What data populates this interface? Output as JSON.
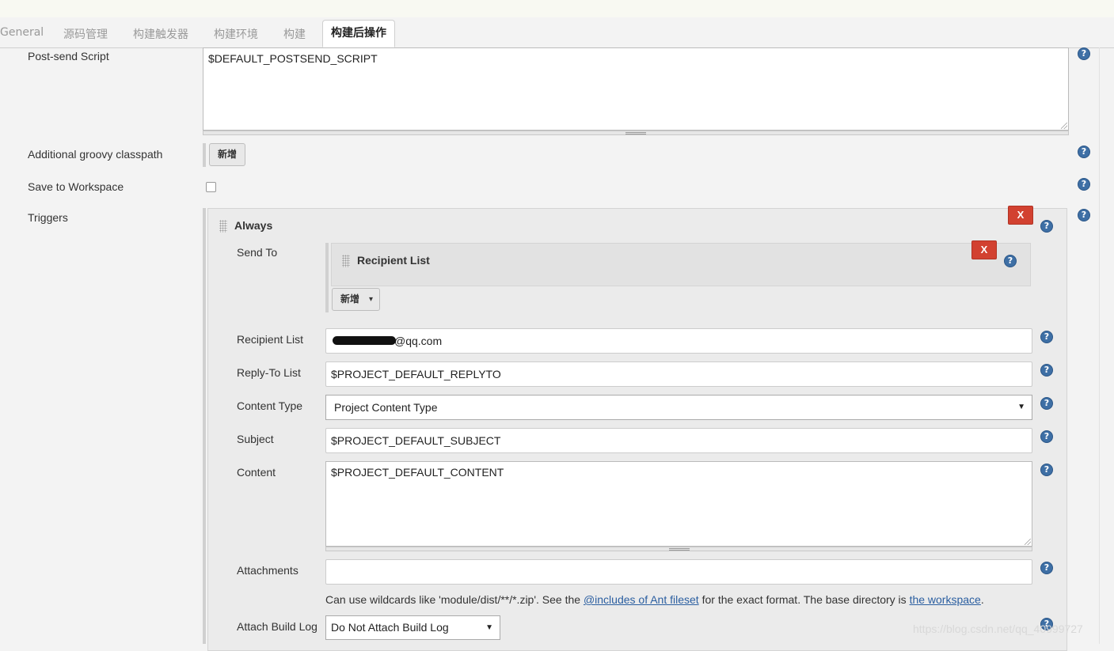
{
  "tabs": [
    {
      "label": "General"
    },
    {
      "label": "源码管理"
    },
    {
      "label": "构建触发器"
    },
    {
      "label": "构建环境"
    },
    {
      "label": "构建"
    },
    {
      "label": "构建后操作",
      "active": true
    }
  ],
  "post_send_script": {
    "label": "Post-send Script",
    "value": "$DEFAULT_POSTSEND_SCRIPT"
  },
  "groovy_classpath": {
    "label": "Additional groovy classpath",
    "add_button": "新增"
  },
  "save_workspace": {
    "label": "Save to Workspace",
    "checked": false
  },
  "triggers": {
    "label": "Triggers",
    "always": {
      "title": "Always",
      "delete_label": "X",
      "send_to": {
        "label": "Send To",
        "recipient_title": "Recipient List",
        "delete_label": "X",
        "add_button": "新增"
      },
      "recipient_list": {
        "label": "Recipient List",
        "value": "@qq.com"
      },
      "reply_to": {
        "label": "Reply-To List",
        "value": "$PROJECT_DEFAULT_REPLYTO"
      },
      "content_type": {
        "label": "Content Type",
        "value": "Project Content Type"
      },
      "subject": {
        "label": "Subject",
        "value": "$PROJECT_DEFAULT_SUBJECT"
      },
      "content": {
        "label": "Content",
        "value": "$PROJECT_DEFAULT_CONTENT"
      },
      "attachments": {
        "label": "Attachments",
        "value": "",
        "note_prefix": "Can use wildcards like 'module/dist/**/*.zip'. See the ",
        "note_link1": "@includes of Ant fileset",
        "note_mid": " for the exact format. The base directory is ",
        "note_link2": "the workspace",
        "note_suffix": "."
      },
      "attach_build_log": {
        "label": "Attach Build Log",
        "value": "Do Not Attach Build Log"
      }
    }
  },
  "help_symbol": "?",
  "dropdown_arrow": "▼",
  "caret": "▾",
  "watermark": "https://blog.csdn.net/qq_40999727"
}
